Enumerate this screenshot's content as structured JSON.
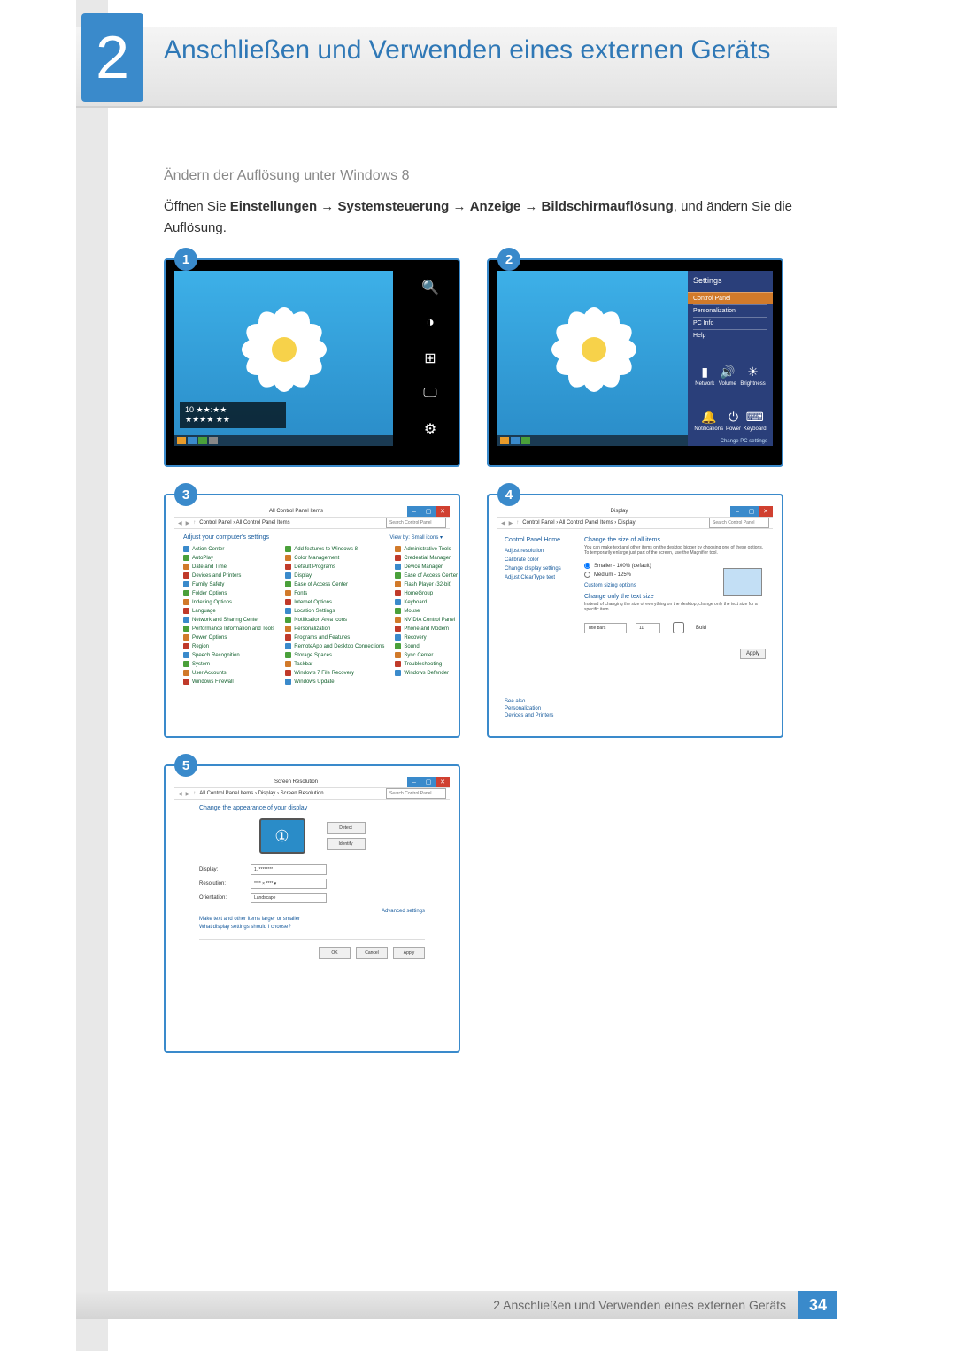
{
  "chapter": {
    "number": "2",
    "title": "Anschließen und Verwenden eines externen Geräts"
  },
  "section_heading": "Ändern der Auflösung unter Windows 8",
  "instruction_pre": "Öffnen Sie ",
  "path": [
    "Einstellungen",
    "Systemsteuerung",
    "Anzeige",
    "Bildschirmauflösung"
  ],
  "instruction_post": ", und ändern Sie die Auflösung.",
  "steps": {
    "1": "1",
    "2": "2",
    "3": "3",
    "4": "4",
    "5": "5"
  },
  "charms": {
    "search": "Search",
    "share": "Share",
    "start": "Start",
    "devices": "Devices",
    "settings": "Settings"
  },
  "clock": {
    "line1": "10  ★★:★★",
    "line2": "★★★★ ★★"
  },
  "settings_pane": {
    "title": "Settings",
    "items": [
      "Control Panel",
      "Personalization",
      "PC Info",
      "Help"
    ],
    "quick": [
      {
        "glyph": "▮",
        "label": "Network"
      },
      {
        "glyph": "🔊",
        "label": "Volume"
      },
      {
        "glyph": "☀",
        "label": "Brightness"
      },
      {
        "glyph": "🔔",
        "label": "Notifications"
      },
      {
        "glyph": "⏻",
        "label": "Power"
      },
      {
        "glyph": "⌨",
        "label": "Keyboard"
      }
    ],
    "footer": "Change PC settings"
  },
  "cp": {
    "title": "All Control Panel Items",
    "breadcrumb": "Control Panel › All Control Panel Items",
    "search_ph": "Search Control Panel",
    "heading": "Adjust your computer's settings",
    "viewby": "View by: Small icons ▾",
    "cols": [
      [
        "Action Center",
        "AutoPlay",
        "Date and Time",
        "Devices and Printers",
        "Family Safety",
        "Folder Options",
        "Indexing Options",
        "Language",
        "Network and Sharing Center",
        "Performance Information and Tools",
        "Power Options",
        "Region",
        "Speech Recognition",
        "System",
        "User Accounts",
        "Windows Firewall"
      ],
      [
        "Add features to Windows 8",
        "Color Management",
        "Default Programs",
        "Display",
        "Ease of Access Center",
        "Fonts",
        "Internet Options",
        "Location Settings",
        "Notification Area Icons",
        "Personalization",
        "Programs and Features",
        "RemoteApp and Desktop Connections",
        "Storage Spaces",
        "Taskbar",
        "Windows 7 File Recovery",
        "Windows Update"
      ],
      [
        "Administrative Tools",
        "Credential Manager",
        "Device Manager",
        "Ease of Access Center",
        "Flash Player (32-bit)",
        "HomeGroup",
        "Keyboard",
        "Mouse",
        "NVIDIA Control Panel",
        "Phone and Modem",
        "Recovery",
        "Sound",
        "Sync Center",
        "Troubleshooting",
        "Windows Defender"
      ]
    ]
  },
  "display": {
    "title": "Display",
    "breadcrumb": "Control Panel › All Control Panel Items › Display",
    "search_ph": "Search Control Panel",
    "side_head": "Control Panel Home",
    "side": [
      "Adjust resolution",
      "Calibrate color",
      "Change display settings",
      "Adjust ClearType text"
    ],
    "h1": "Change the size of all items",
    "sub": "You can make text and other items on the desktop bigger by choosing one of these options. To temporarily enlarge just part of the screen, use the Magnifier tool.",
    "opt_small": "Smaller - 100% (default)",
    "opt_med": "Medium - 125%",
    "custom": "Custom sizing options",
    "h2": "Change only the text size",
    "sub2": "Instead of changing the size of everything on the desktop, change only the text size for a specific item.",
    "combo": "Title bars",
    "size": "11",
    "bold": "Bold",
    "apply": "Apply",
    "see_also": "See also",
    "sa1": "Personalization",
    "sa2": "Devices and Printers"
  },
  "sr": {
    "title": "Screen Resolution",
    "breadcrumb": "All Control Panel Items › Display › Screen Resolution",
    "search_ph": "Search Control Panel",
    "heading": "Change the appearance of your display",
    "detect": "Detect",
    "identify": "Identify",
    "display_lbl": "Display:",
    "display_val": "1. ********",
    "res_lbl": "Resolution:",
    "res_val": "**** × **** ▾",
    "orient_lbl": "Orientation:",
    "orient_val": "Landscape",
    "advanced": "Advanced settings",
    "link1": "Make text and other items larger or smaller",
    "link2": "What display settings should I choose?",
    "ok": "OK",
    "cancel": "Cancel",
    "apply": "Apply"
  },
  "footer": {
    "text": "2 Anschließen und Verwenden eines externen Geräts",
    "page": "34"
  }
}
